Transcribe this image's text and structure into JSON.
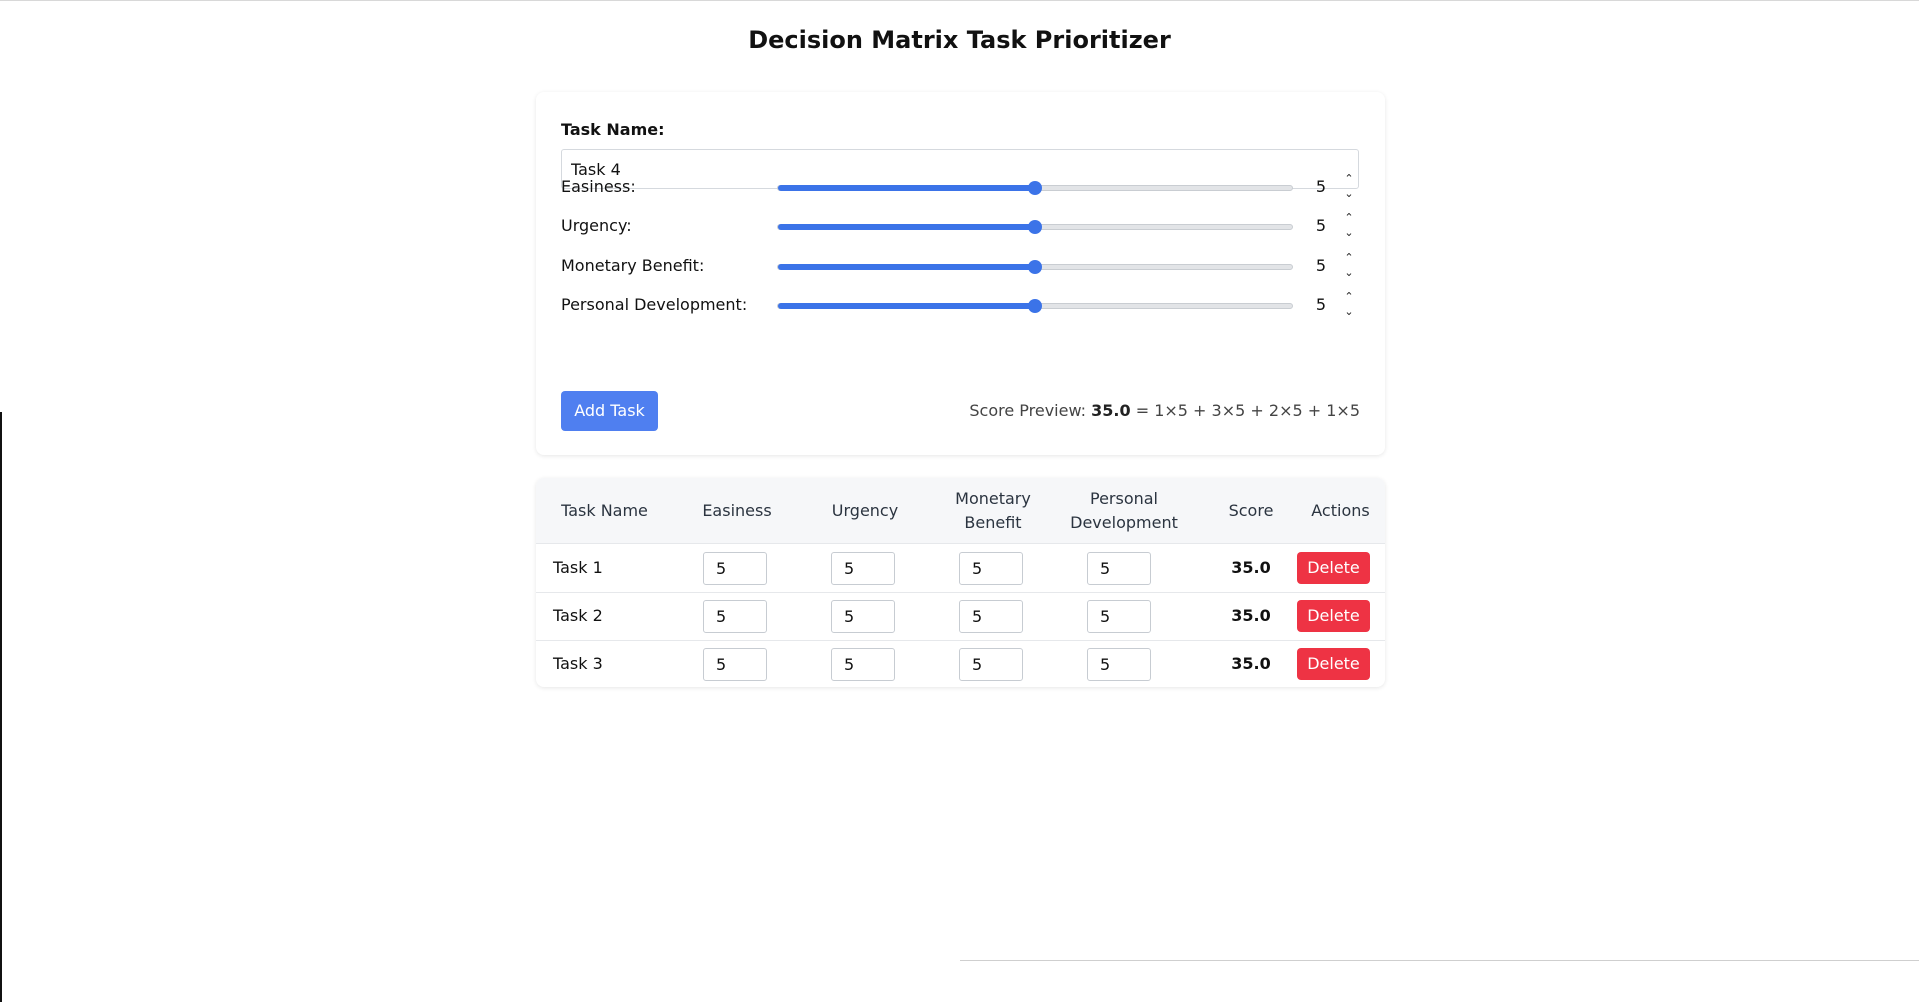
{
  "title": "Decision Matrix Task Prioritizer",
  "form": {
    "task_name_label": "Task Name:",
    "task_name_value": "Task 4",
    "sliders": [
      {
        "label": "Easiness:",
        "value": "5",
        "fraction": 0.5
      },
      {
        "label": "Urgency:",
        "value": "5",
        "fraction": 0.5
      },
      {
        "label": "Monetary Benefit:",
        "value": "5",
        "fraction": 0.5
      },
      {
        "label": "Personal Development:",
        "value": "5",
        "fraction": 0.5
      }
    ],
    "add_button_label": "Add Task",
    "score_preview": {
      "label": "Score Preview: ",
      "value": "35.0",
      "formula": " = 1×5 + 3×5 + 2×5 + 1×5"
    }
  },
  "table": {
    "headers": {
      "task_name": "Task Name",
      "easiness": "Easiness",
      "urgency": "Urgency",
      "monetary_line1": "Monetary",
      "monetary_line2": "Benefit",
      "personal_line1": "Personal",
      "personal_line2": "Development",
      "score": "Score",
      "actions": "Actions"
    },
    "rows": [
      {
        "name": "Task 1",
        "easiness": "5",
        "urgency": "5",
        "monetary": "5",
        "personal": "5",
        "score": "35.0",
        "delete_label": "Delete"
      },
      {
        "name": "Task 2",
        "easiness": "5",
        "urgency": "5",
        "monetary": "5",
        "personal": "5",
        "score": "35.0",
        "delete_label": "Delete"
      },
      {
        "name": "Task 3",
        "easiness": "5",
        "urgency": "5",
        "monetary": "5",
        "personal": "5",
        "score": "35.0",
        "delete_label": "Delete"
      }
    ]
  },
  "colors": {
    "accent": "#3b73e8",
    "add_button": "#4f7ff0",
    "delete_button": "#ee3344"
  }
}
